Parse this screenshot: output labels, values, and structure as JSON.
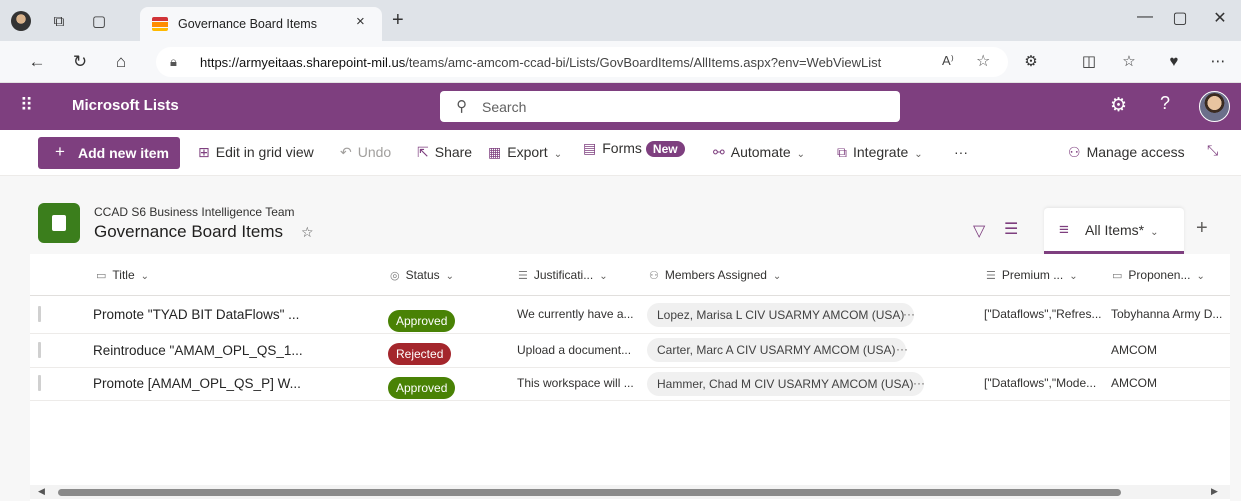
{
  "browser": {
    "tab_title": "Governance Board Items",
    "tab_close": "×",
    "new_tab": "+",
    "url_host": "https://armyeitaas.sharepoint-mil.us",
    "url_path": "/teams/amc-amcom-ccad-bi/Lists/GovBoardItems/AllItems.aspx?env=WebViewList",
    "read_aloud": "A⁾",
    "window": {
      "minimize": "—",
      "maximize": "▢",
      "close": "✕"
    }
  },
  "suite": {
    "app_name": "Microsoft Lists",
    "search_placeholder": "Search",
    "help": "?"
  },
  "commands": {
    "add_new_item": "Add new item",
    "edit_grid": "Edit in grid view",
    "undo": "Undo",
    "share": "Share",
    "export": "Export",
    "forms": "Forms",
    "forms_badge": "New",
    "automate": "Automate",
    "integrate": "Integrate",
    "overflow": "···",
    "manage_access": "Manage access"
  },
  "list": {
    "site_name": "CCAD S6 Business Intelligence Team",
    "title": "Governance Board Items",
    "view_label": "All Items*",
    "add_view": "+"
  },
  "columns": {
    "title": "Title",
    "status": "Status",
    "justification": "Justificati...",
    "members": "Members Assigned",
    "premium": "Premium ...",
    "proponent": "Proponen..."
  },
  "rows": [
    {
      "title": "Promote \"TYAD BIT DataFlows\" ...",
      "status": "Approved",
      "status_color": "#498205",
      "justification": "We currently have a...",
      "member": "Lopez, Marisa L CIV USARMY AMCOM (USA)",
      "premium": "[\"Dataflows\",\"Refres...",
      "proponent": "Tobyhanna Army D..."
    },
    {
      "title": "Reintroduce \"AMAM_OPL_QS_1...",
      "status": "Rejected",
      "status_color": "#a4262c",
      "justification": "Upload a document...",
      "member": "Carter, Marc A CIV USARMY AMCOM (USA)",
      "premium": "",
      "proponent": "AMCOM"
    },
    {
      "title": "Promote [AMAM_OPL_QS_P] W...",
      "status": "Approved",
      "status_color": "#498205",
      "justification": "This workspace will ...",
      "member": "Hammer, Chad M CIV USARMY AMCOM (USA)",
      "premium": "[\"Dataflows\",\"Mode...",
      "proponent": "AMCOM"
    }
  ],
  "colors": {
    "brand": "#7e3f7f",
    "approved": "#498205",
    "rejected": "#a4262c"
  }
}
